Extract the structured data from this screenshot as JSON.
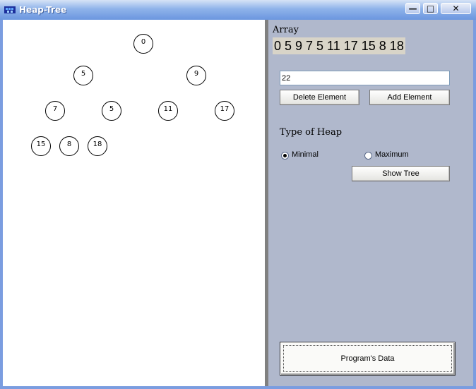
{
  "window": {
    "title": "Heap-Tree",
    "controls": {
      "minimize": "—",
      "maximize": "□",
      "close": "✕"
    }
  },
  "tree": {
    "nodes": [
      "0",
      "5",
      "9",
      "7",
      "5",
      "11",
      "17",
      "15",
      "8",
      "18"
    ]
  },
  "panel": {
    "array_label": "Array",
    "array_values": "0 5 9 7 5 11 17 15 8 18",
    "input_value": "22",
    "delete_label": "Delete Element",
    "add_label": "Add Element",
    "heap_type_label": "Type of Heap",
    "radio_minimal": "Minimal",
    "radio_maximum": "Maximum",
    "selected_type": "Minimal",
    "show_tree_label": "Show Tree",
    "program_data_label": "Program's Data"
  },
  "colors": {
    "panel_bg": "#b0b8cc",
    "titlebar": "#6b96df",
    "array_bg": "#d8d4c8"
  }
}
